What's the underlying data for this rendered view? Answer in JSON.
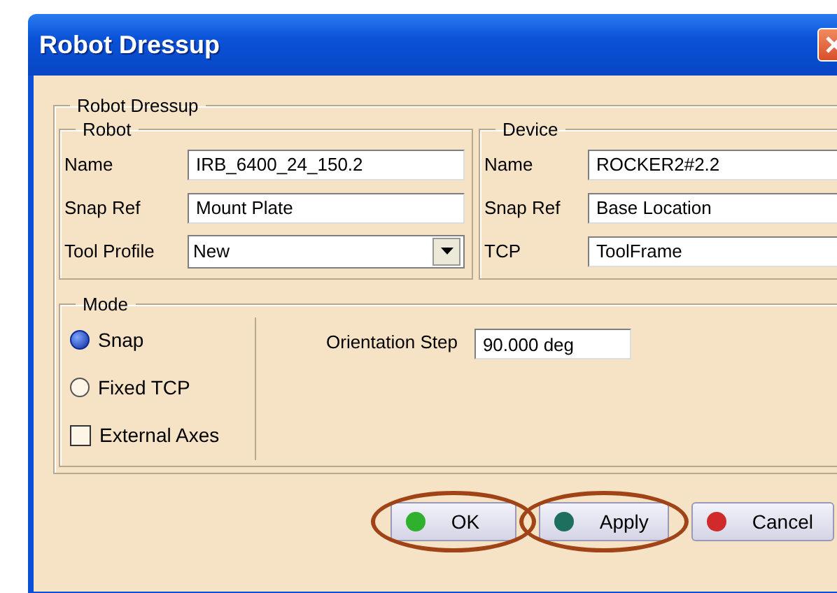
{
  "window": {
    "title": "Robot Dressup"
  },
  "group": {
    "title": "Robot Dressup"
  },
  "robot": {
    "title": "Robot",
    "fields": [
      {
        "label": "Name",
        "value": "IRB_6400_24_150.2",
        "kind": "text"
      },
      {
        "label": "Snap Ref",
        "value": "Mount Plate",
        "kind": "text"
      },
      {
        "label": "Tool Profile",
        "value": "New",
        "kind": "dropdown"
      }
    ]
  },
  "device": {
    "title": "Device",
    "fields": [
      {
        "label": "Name",
        "value": "ROCKER2#2.2",
        "kind": "text"
      },
      {
        "label": "Snap Ref",
        "value": "Base Location",
        "kind": "text"
      },
      {
        "label": "TCP",
        "value": "ToolFrame",
        "kind": "text"
      }
    ]
  },
  "mode": {
    "title": "Mode",
    "options": [
      {
        "label": "Snap",
        "kind": "radio",
        "selected": true
      },
      {
        "label": "Fixed TCP",
        "kind": "radio",
        "selected": false
      },
      {
        "label": "External Axes",
        "kind": "checkbox",
        "checked": false
      }
    ],
    "orientation_step": {
      "label": "Orientation Step",
      "value": "90.000 deg"
    }
  },
  "buttons": [
    {
      "label": "OK",
      "color": "#2fb02f",
      "highlighted": true
    },
    {
      "label": "Apply",
      "color": "#1f6f5f",
      "highlighted": true
    },
    {
      "label": "Cancel",
      "color": "#d02a2a",
      "highlighted": false
    }
  ]
}
